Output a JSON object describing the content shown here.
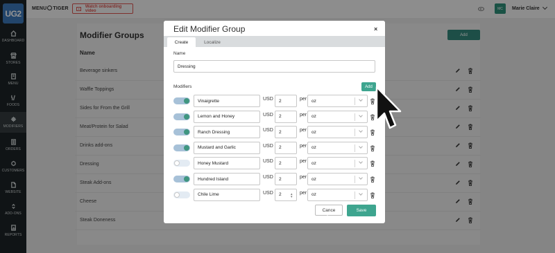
{
  "sidebar": {
    "logo": "UG2",
    "items": [
      {
        "label": "DASHBOARD",
        "icon": "home-icon"
      },
      {
        "label": "STORES",
        "icon": "store-icon"
      },
      {
        "label": "MENU",
        "icon": "menu-book-icon"
      },
      {
        "label": "FOODS",
        "icon": "utensils-icon"
      },
      {
        "label": "MODIFIERS",
        "icon": "modifiers-icon"
      },
      {
        "label": "ORDERS",
        "icon": "orders-icon"
      },
      {
        "label": "CUSTOMERS",
        "icon": "customers-icon"
      },
      {
        "label": "WEBSITE",
        "icon": "website-icon"
      },
      {
        "label": "ADD-ONS",
        "icon": "addons-icon"
      },
      {
        "label": "REPORTS",
        "icon": "reports-icon"
      }
    ],
    "active_index": 4
  },
  "header": {
    "brand_left": "MENU",
    "brand_right": "TIGER",
    "onboarding_label": "Watch onboarding video",
    "avatar_initials": "MC",
    "user_name": "Marie Claire"
  },
  "page": {
    "title": "Modifier Groups",
    "add_label": "Add",
    "column_name": "Name",
    "groups": [
      "Beverage sinkers",
      "Waffle Toppings",
      "Sides for From the Grill",
      "Meat/Protein for Salad",
      "Drinks add-ons",
      "Dressing",
      "Steak Add-ons",
      "Cheese",
      "Steak Doneness"
    ]
  },
  "modal": {
    "title": "Edit Modifier Group",
    "close_glyph": "×",
    "tabs": [
      "Create",
      "Localize"
    ],
    "active_tab": 0,
    "name_label": "Name",
    "name_value": "Dressing",
    "modifiers_label": "Modifiers",
    "add_label": "Add",
    "currency_label": "USD",
    "per_label": "per",
    "modifiers": [
      {
        "name": "Vinaigrette",
        "price": "2",
        "unit": "oz",
        "enabled": true
      },
      {
        "name": "Lemon and Honey",
        "price": "2",
        "unit": "oz",
        "enabled": true
      },
      {
        "name": "Ranch Dressing",
        "price": "2",
        "unit": "oz",
        "enabled": true
      },
      {
        "name": "Mustard and Garlic",
        "price": "2",
        "unit": "oz",
        "enabled": true
      },
      {
        "name": "Honey Mustard",
        "price": "2",
        "unit": "oz",
        "enabled": false
      },
      {
        "name": "Hundred Island",
        "price": "2",
        "unit": "oz",
        "enabled": true
      },
      {
        "name": "Chile Lime",
        "price": "2",
        "unit": "oz",
        "enabled": false
      }
    ],
    "cancel_label": "Cance",
    "save_label": "Save"
  },
  "colors": {
    "accent": "#3ea58f",
    "sidebar": "#1d2426",
    "logo": "#3b78b8",
    "alert": "#d9534f"
  }
}
